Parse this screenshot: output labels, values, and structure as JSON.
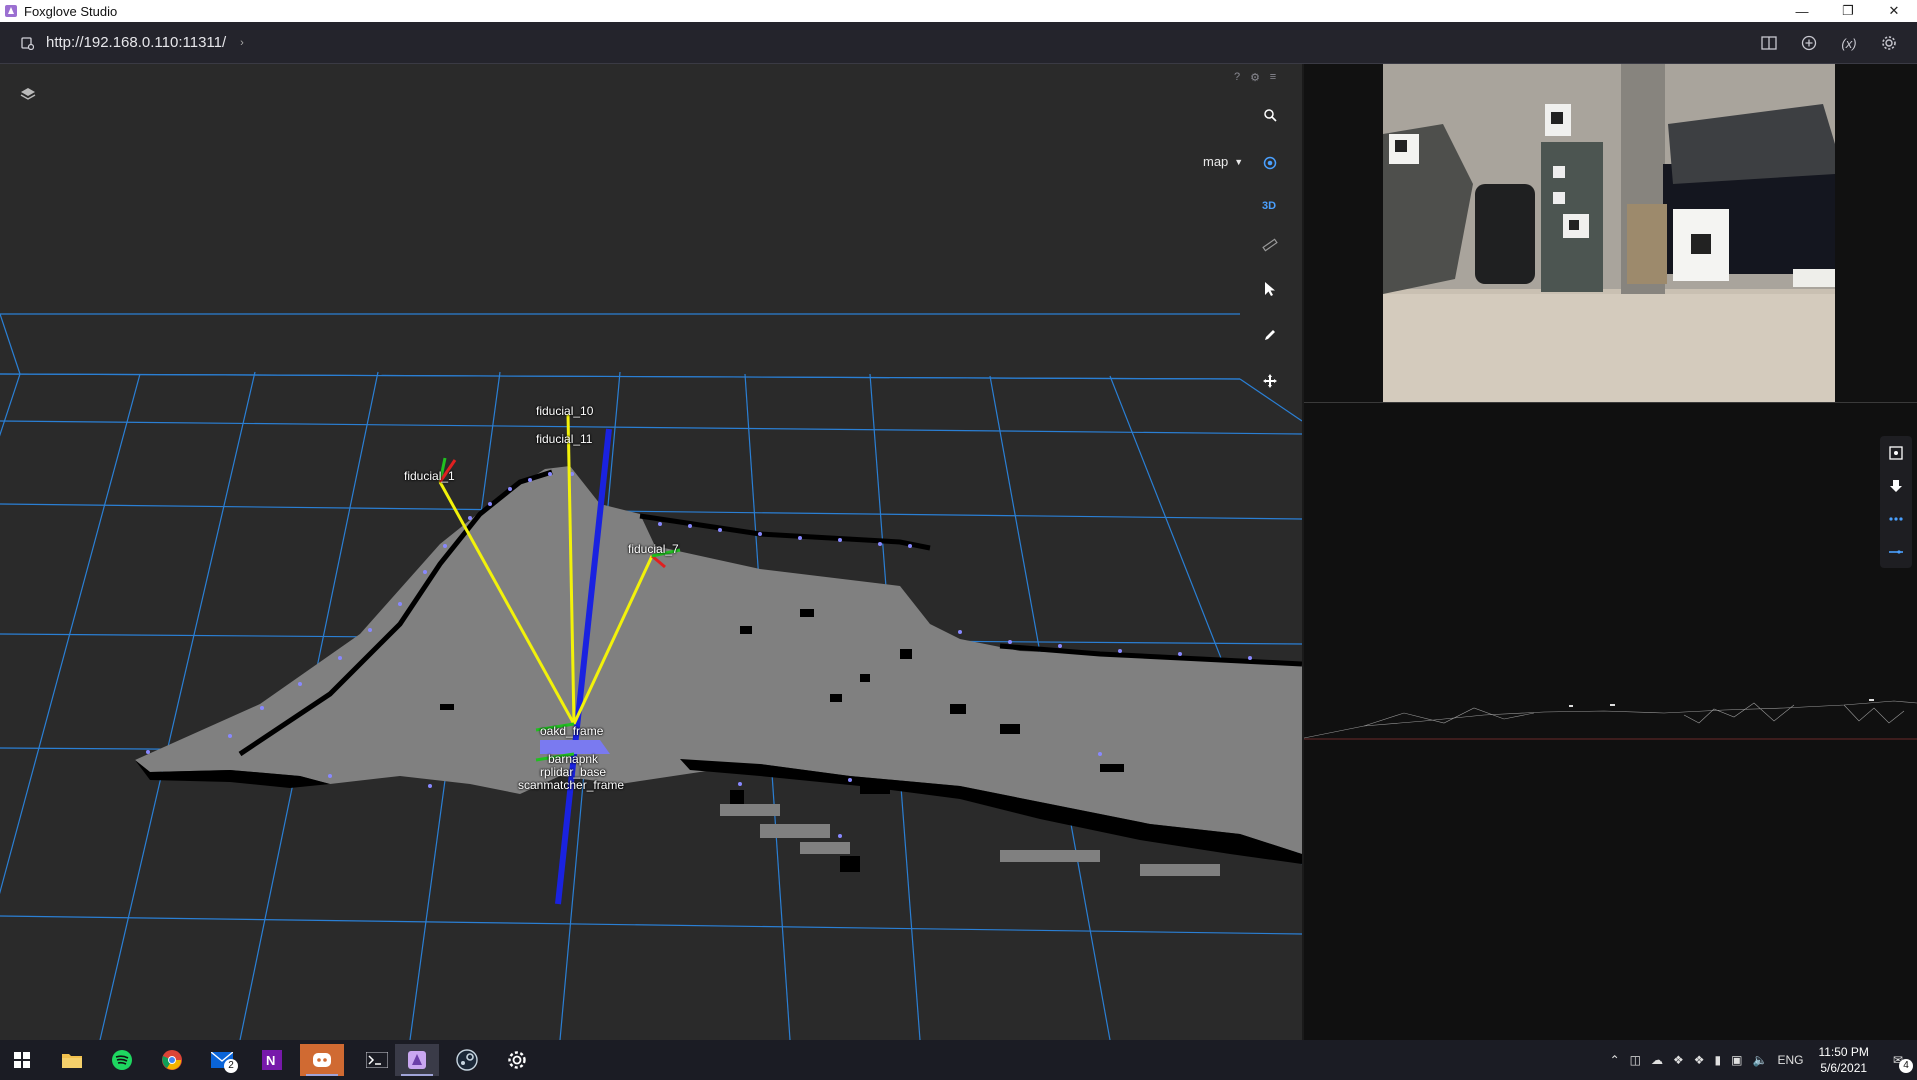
{
  "window": {
    "title": "Foxglove Studio"
  },
  "toolbar": {
    "connection_url": "http://192.168.0.110:11311/"
  },
  "scene": {
    "frame_selector": "map",
    "mode_button": "3D",
    "labels": {
      "fiducial_10": "fiducial_10",
      "fiducial_11": "fiducial_11",
      "fiducial_1": "fiducial_1",
      "fiducial_7": "fiducial_7",
      "oakd_frame": "oakd_frame",
      "barnapnk": "barnapnk",
      "rplidar_base": "rplidar_base",
      "scanmatcher_frame": "scanmatcher_frame"
    },
    "colors": {
      "grid": "#2a7fd4",
      "map_free": "#808080",
      "axis_z": "#1a22e0",
      "fiducial_lines": "#f2f20a",
      "scan_points": "#8888ff"
    }
  },
  "taskbar": {
    "lang": "ENG",
    "time": "11:50 PM",
    "date": "5/6/2021",
    "mail_badge": "2",
    "notif_badge": "4",
    "apps": [
      "windows-logo",
      "file-explorer",
      "spotify",
      "chrome",
      "mail",
      "onenote",
      "discord",
      "terminal",
      "foxglove",
      "steam",
      "settings"
    ]
  }
}
